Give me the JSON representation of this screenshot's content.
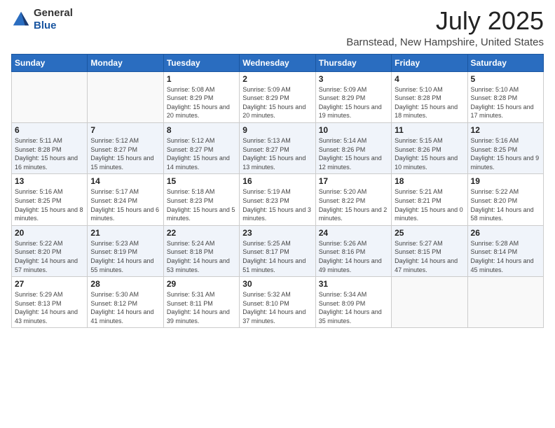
{
  "header": {
    "logo_general": "General",
    "logo_blue": "Blue",
    "month_year": "July 2025",
    "location": "Barnstead, New Hampshire, United States"
  },
  "days_of_week": [
    "Sunday",
    "Monday",
    "Tuesday",
    "Wednesday",
    "Thursday",
    "Friday",
    "Saturday"
  ],
  "weeks": [
    {
      "days": [
        {
          "number": "",
          "sunrise": "",
          "sunset": "",
          "daylight": "",
          "empty": true
        },
        {
          "number": "",
          "sunrise": "",
          "sunset": "",
          "daylight": "",
          "empty": true
        },
        {
          "number": "1",
          "sunrise": "Sunrise: 5:08 AM",
          "sunset": "Sunset: 8:29 PM",
          "daylight": "Daylight: 15 hours and 20 minutes."
        },
        {
          "number": "2",
          "sunrise": "Sunrise: 5:09 AM",
          "sunset": "Sunset: 8:29 PM",
          "daylight": "Daylight: 15 hours and 20 minutes."
        },
        {
          "number": "3",
          "sunrise": "Sunrise: 5:09 AM",
          "sunset": "Sunset: 8:29 PM",
          "daylight": "Daylight: 15 hours and 19 minutes."
        },
        {
          "number": "4",
          "sunrise": "Sunrise: 5:10 AM",
          "sunset": "Sunset: 8:28 PM",
          "daylight": "Daylight: 15 hours and 18 minutes."
        },
        {
          "number": "5",
          "sunrise": "Sunrise: 5:10 AM",
          "sunset": "Sunset: 8:28 PM",
          "daylight": "Daylight: 15 hours and 17 minutes."
        }
      ]
    },
    {
      "days": [
        {
          "number": "6",
          "sunrise": "Sunrise: 5:11 AM",
          "sunset": "Sunset: 8:28 PM",
          "daylight": "Daylight: 15 hours and 16 minutes."
        },
        {
          "number": "7",
          "sunrise": "Sunrise: 5:12 AM",
          "sunset": "Sunset: 8:27 PM",
          "daylight": "Daylight: 15 hours and 15 minutes."
        },
        {
          "number": "8",
          "sunrise": "Sunrise: 5:12 AM",
          "sunset": "Sunset: 8:27 PM",
          "daylight": "Daylight: 15 hours and 14 minutes."
        },
        {
          "number": "9",
          "sunrise": "Sunrise: 5:13 AM",
          "sunset": "Sunset: 8:27 PM",
          "daylight": "Daylight: 15 hours and 13 minutes."
        },
        {
          "number": "10",
          "sunrise": "Sunrise: 5:14 AM",
          "sunset": "Sunset: 8:26 PM",
          "daylight": "Daylight: 15 hours and 12 minutes."
        },
        {
          "number": "11",
          "sunrise": "Sunrise: 5:15 AM",
          "sunset": "Sunset: 8:26 PM",
          "daylight": "Daylight: 15 hours and 10 minutes."
        },
        {
          "number": "12",
          "sunrise": "Sunrise: 5:16 AM",
          "sunset": "Sunset: 8:25 PM",
          "daylight": "Daylight: 15 hours and 9 minutes."
        }
      ]
    },
    {
      "days": [
        {
          "number": "13",
          "sunrise": "Sunrise: 5:16 AM",
          "sunset": "Sunset: 8:25 PM",
          "daylight": "Daylight: 15 hours and 8 minutes."
        },
        {
          "number": "14",
          "sunrise": "Sunrise: 5:17 AM",
          "sunset": "Sunset: 8:24 PM",
          "daylight": "Daylight: 15 hours and 6 minutes."
        },
        {
          "number": "15",
          "sunrise": "Sunrise: 5:18 AM",
          "sunset": "Sunset: 8:23 PM",
          "daylight": "Daylight: 15 hours and 5 minutes."
        },
        {
          "number": "16",
          "sunrise": "Sunrise: 5:19 AM",
          "sunset": "Sunset: 8:23 PM",
          "daylight": "Daylight: 15 hours and 3 minutes."
        },
        {
          "number": "17",
          "sunrise": "Sunrise: 5:20 AM",
          "sunset": "Sunset: 8:22 PM",
          "daylight": "Daylight: 15 hours and 2 minutes."
        },
        {
          "number": "18",
          "sunrise": "Sunrise: 5:21 AM",
          "sunset": "Sunset: 8:21 PM",
          "daylight": "Daylight: 15 hours and 0 minutes."
        },
        {
          "number": "19",
          "sunrise": "Sunrise: 5:22 AM",
          "sunset": "Sunset: 8:20 PM",
          "daylight": "Daylight: 14 hours and 58 minutes."
        }
      ]
    },
    {
      "days": [
        {
          "number": "20",
          "sunrise": "Sunrise: 5:22 AM",
          "sunset": "Sunset: 8:20 PM",
          "daylight": "Daylight: 14 hours and 57 minutes."
        },
        {
          "number": "21",
          "sunrise": "Sunrise: 5:23 AM",
          "sunset": "Sunset: 8:19 PM",
          "daylight": "Daylight: 14 hours and 55 minutes."
        },
        {
          "number": "22",
          "sunrise": "Sunrise: 5:24 AM",
          "sunset": "Sunset: 8:18 PM",
          "daylight": "Daylight: 14 hours and 53 minutes."
        },
        {
          "number": "23",
          "sunrise": "Sunrise: 5:25 AM",
          "sunset": "Sunset: 8:17 PM",
          "daylight": "Daylight: 14 hours and 51 minutes."
        },
        {
          "number": "24",
          "sunrise": "Sunrise: 5:26 AM",
          "sunset": "Sunset: 8:16 PM",
          "daylight": "Daylight: 14 hours and 49 minutes."
        },
        {
          "number": "25",
          "sunrise": "Sunrise: 5:27 AM",
          "sunset": "Sunset: 8:15 PM",
          "daylight": "Daylight: 14 hours and 47 minutes."
        },
        {
          "number": "26",
          "sunrise": "Sunrise: 5:28 AM",
          "sunset": "Sunset: 8:14 PM",
          "daylight": "Daylight: 14 hours and 45 minutes."
        }
      ]
    },
    {
      "days": [
        {
          "number": "27",
          "sunrise": "Sunrise: 5:29 AM",
          "sunset": "Sunset: 8:13 PM",
          "daylight": "Daylight: 14 hours and 43 minutes."
        },
        {
          "number": "28",
          "sunrise": "Sunrise: 5:30 AM",
          "sunset": "Sunset: 8:12 PM",
          "daylight": "Daylight: 14 hours and 41 minutes."
        },
        {
          "number": "29",
          "sunrise": "Sunrise: 5:31 AM",
          "sunset": "Sunset: 8:11 PM",
          "daylight": "Daylight: 14 hours and 39 minutes."
        },
        {
          "number": "30",
          "sunrise": "Sunrise: 5:32 AM",
          "sunset": "Sunset: 8:10 PM",
          "daylight": "Daylight: 14 hours and 37 minutes."
        },
        {
          "number": "31",
          "sunrise": "Sunrise: 5:34 AM",
          "sunset": "Sunset: 8:09 PM",
          "daylight": "Daylight: 14 hours and 35 minutes."
        },
        {
          "number": "",
          "sunrise": "",
          "sunset": "",
          "daylight": "",
          "empty": true
        },
        {
          "number": "",
          "sunrise": "",
          "sunset": "",
          "daylight": "",
          "empty": true
        }
      ]
    }
  ]
}
